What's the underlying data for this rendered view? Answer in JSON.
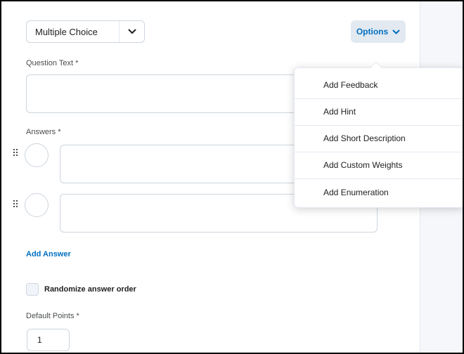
{
  "question_type": {
    "selected": "Multiple Choice"
  },
  "options_button": {
    "label": "Options"
  },
  "question_text": {
    "label": "Question Text *",
    "value": ""
  },
  "answers": {
    "label": "Answers *",
    "items": [
      {
        "value": ""
      },
      {
        "value": ""
      }
    ],
    "add_label": "Add Answer"
  },
  "randomize": {
    "label": "Randomize answer order",
    "checked": false
  },
  "default_points": {
    "label": "Default Points *",
    "value": "1"
  },
  "options_menu": {
    "items": [
      {
        "label": "Add Feedback"
      },
      {
        "label": "Add Hint"
      },
      {
        "label": "Add Short Description"
      },
      {
        "label": "Add Custom Weights"
      },
      {
        "label": "Add Enumeration"
      }
    ]
  },
  "colors": {
    "accent": "#006fbf",
    "border": "#cdd5dc",
    "button_bg": "#e3e9f1",
    "side_pane": "#f5f7fa"
  }
}
